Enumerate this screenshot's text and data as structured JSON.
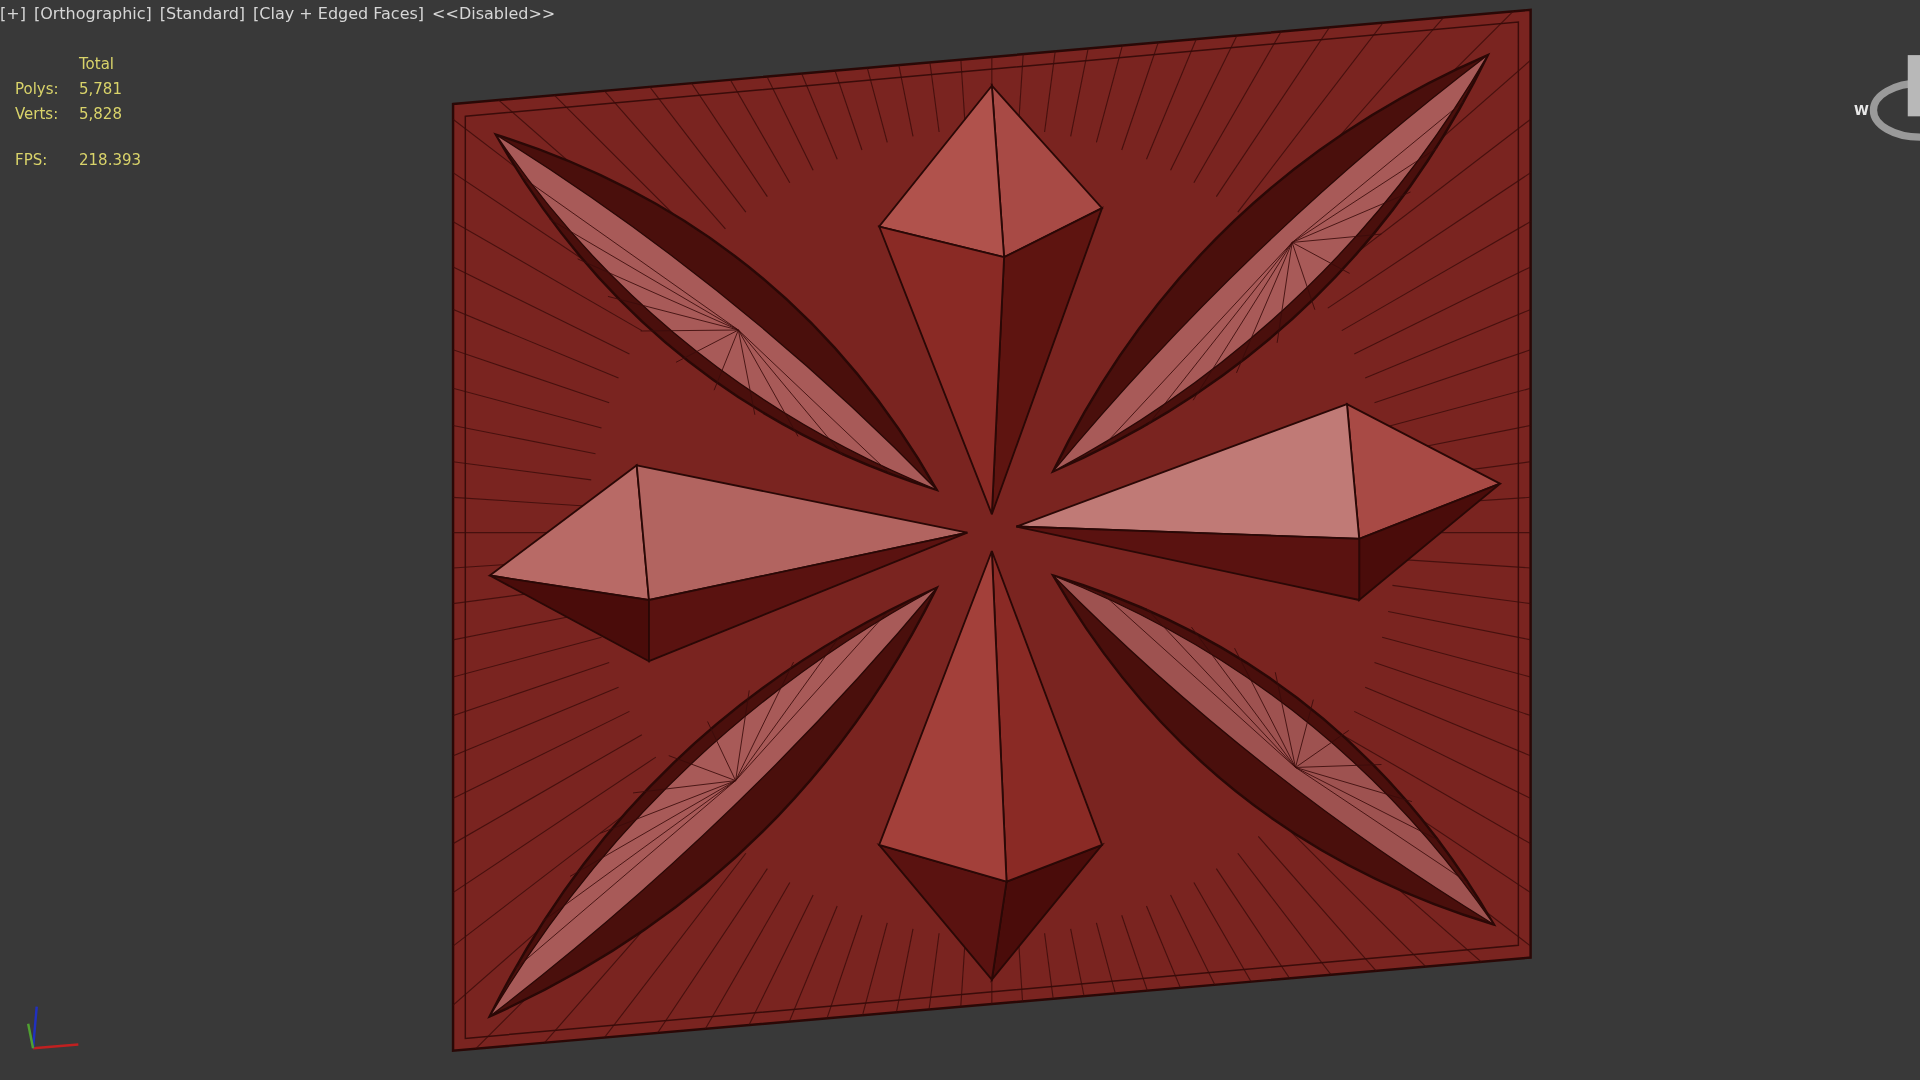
{
  "viewport": {
    "labels": [
      {
        "text": "[+]"
      },
      {
        "text": "[Orthographic]"
      },
      {
        "text": "[Standard]"
      },
      {
        "text": "[Clay + Edged Faces]"
      },
      {
        "text": "<<Disabled>>"
      }
    ]
  },
  "stats": {
    "header": "Total",
    "rows": [
      {
        "label": "Polys:",
        "value": "5,781"
      },
      {
        "label": "Verts:",
        "value": "5,828"
      }
    ],
    "fps": {
      "label": "FPS:",
      "value": "218.393"
    }
  },
  "viewcube": {
    "compass_letter": "W"
  }
}
